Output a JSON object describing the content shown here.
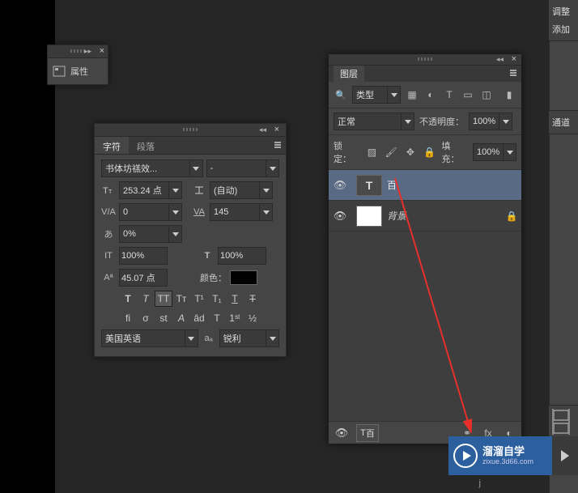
{
  "properties_panel": {
    "title": "属性"
  },
  "character_panel": {
    "tabs": {
      "char": "字符",
      "para": "段落"
    },
    "font_family": "书体坊禚效...",
    "font_style": "-",
    "font_size": "253.24 点",
    "leading": "(自动)",
    "va": "0",
    "tracking": "145",
    "tsume": "0%",
    "vert_scale": "100%",
    "horiz_scale": "100%",
    "baseline": "45.07 点",
    "color_label": "颜色：",
    "language": "美国英语",
    "antialiasing": "锐利"
  },
  "layers_panel": {
    "title": "图层",
    "kind_label": "类型",
    "blend_mode": "正常",
    "opacity_label": "不透明度：",
    "opacity": "100%",
    "lock_label": "锁定：",
    "fill_label": "填充：",
    "fill": "100%",
    "layers": [
      {
        "name": "百",
        "type": "text",
        "selected": true,
        "locked": false
      },
      {
        "name": "背景",
        "type": "bg",
        "selected": false,
        "locked": true
      }
    ],
    "footer_thumb": "百"
  },
  "right_sidebar": {
    "adjust": "调整",
    "add": "添加",
    "channels": "通道"
  },
  "watermark": {
    "brand": "溜溜自学",
    "url": "zixue.3d66.com",
    "sub": "j"
  }
}
